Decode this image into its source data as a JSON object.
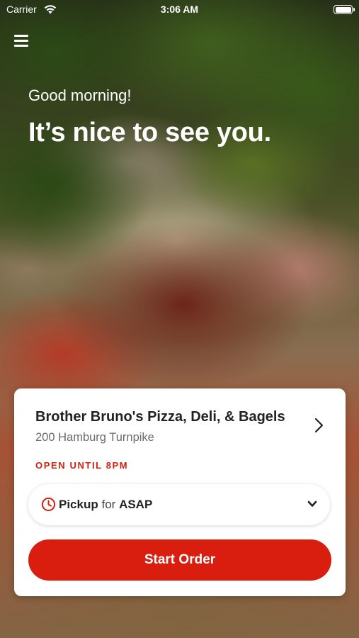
{
  "status_bar": {
    "carrier": "Carrier",
    "time": "3:06 AM",
    "wifi_icon": "wifi-icon",
    "battery_icon": "battery-icon"
  },
  "header": {
    "menu_icon": "hamburger-menu-icon",
    "greeting": "Good morning!",
    "headline": "It’s nice to see you."
  },
  "store": {
    "name": "Brother Bruno's Pizza, Deli, & Bagels",
    "address": "200 Hamburg Turnpike",
    "open_status": "OPEN UNTIL 8PM",
    "chevron_icon": "chevron-right-icon"
  },
  "order_mode": {
    "icon": "clock-icon",
    "mode": "Pickup",
    "connector": "for",
    "time": "ASAP",
    "dropdown_icon": "chevron-down-icon"
  },
  "actions": {
    "start_order_label": "Start Order"
  },
  "colors": {
    "brand_red": "#d91d0e",
    "card_bg": "#ffffff",
    "text_dark": "#222222",
    "text_muted": "#6b6b6b"
  }
}
